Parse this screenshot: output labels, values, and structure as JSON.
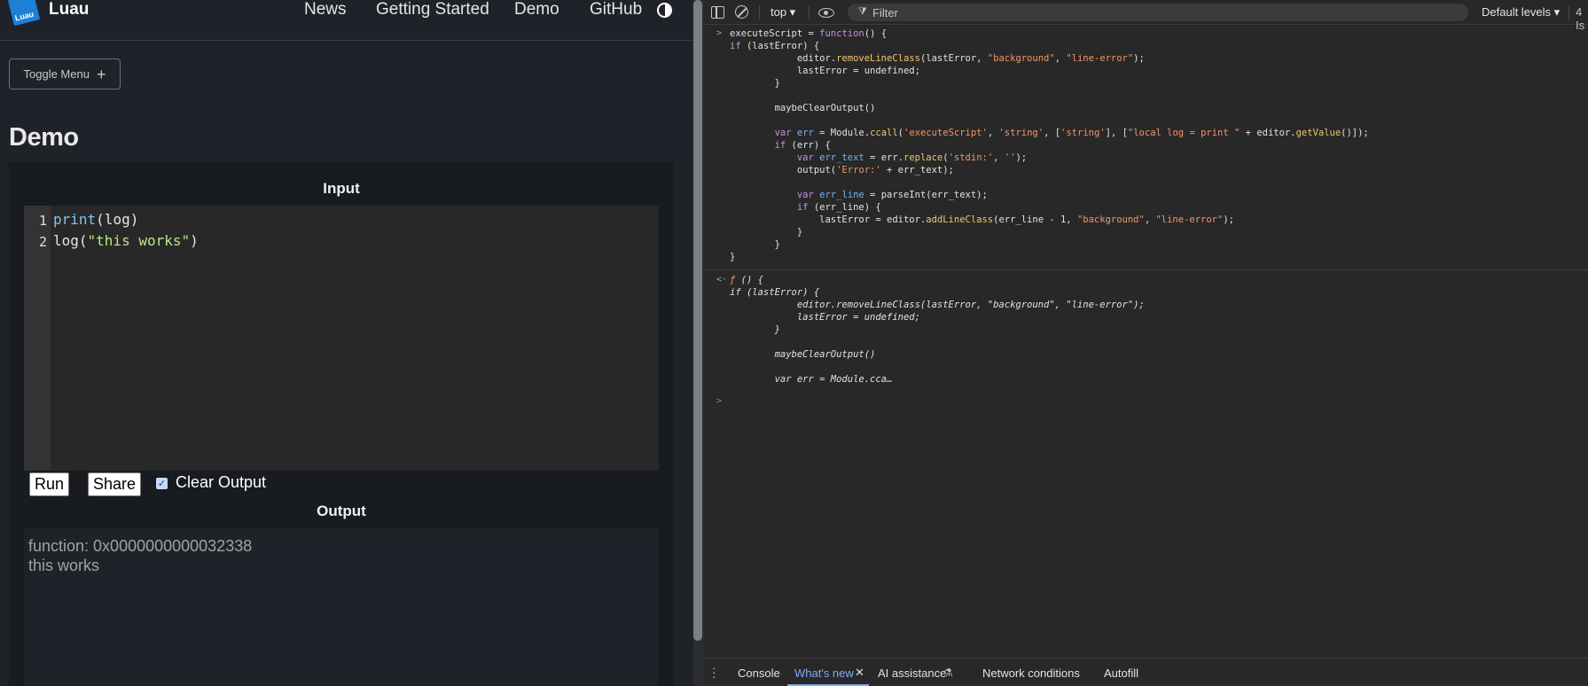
{
  "site": {
    "brand": "Luau",
    "logo_text": "Luau",
    "nav": [
      "News",
      "Getting Started",
      "Demo",
      "GitHub"
    ]
  },
  "toggle_menu_label": "Toggle Menu",
  "page_title": "Demo",
  "demo": {
    "input_title": "Input",
    "output_title": "Output",
    "line_numbers": [
      "1",
      "2"
    ],
    "run_label": "Run",
    "share_label": "Share",
    "clear_output_label": "Clear Output",
    "clear_output_checked": true,
    "output_lines": [
      "function: 0x0000000000032338",
      "this works"
    ]
  },
  "devtools": {
    "context": "top ▾",
    "filter_placeholder": "Filter",
    "levels": "Default levels ▾",
    "issues": "4 Is",
    "drawer_tabs": [
      "Console",
      "What's new",
      "AI assistance",
      "Network conditions",
      "Autofill"
    ],
    "active_drawer_tab": "What's new"
  },
  "colors": {
    "page_bg": "#1f2228",
    "devtools_bg": "#282828",
    "accent_blue": "#7cacf8",
    "keyword": "#c88ee6",
    "string": "#f29766",
    "function": "#f0c674"
  }
}
